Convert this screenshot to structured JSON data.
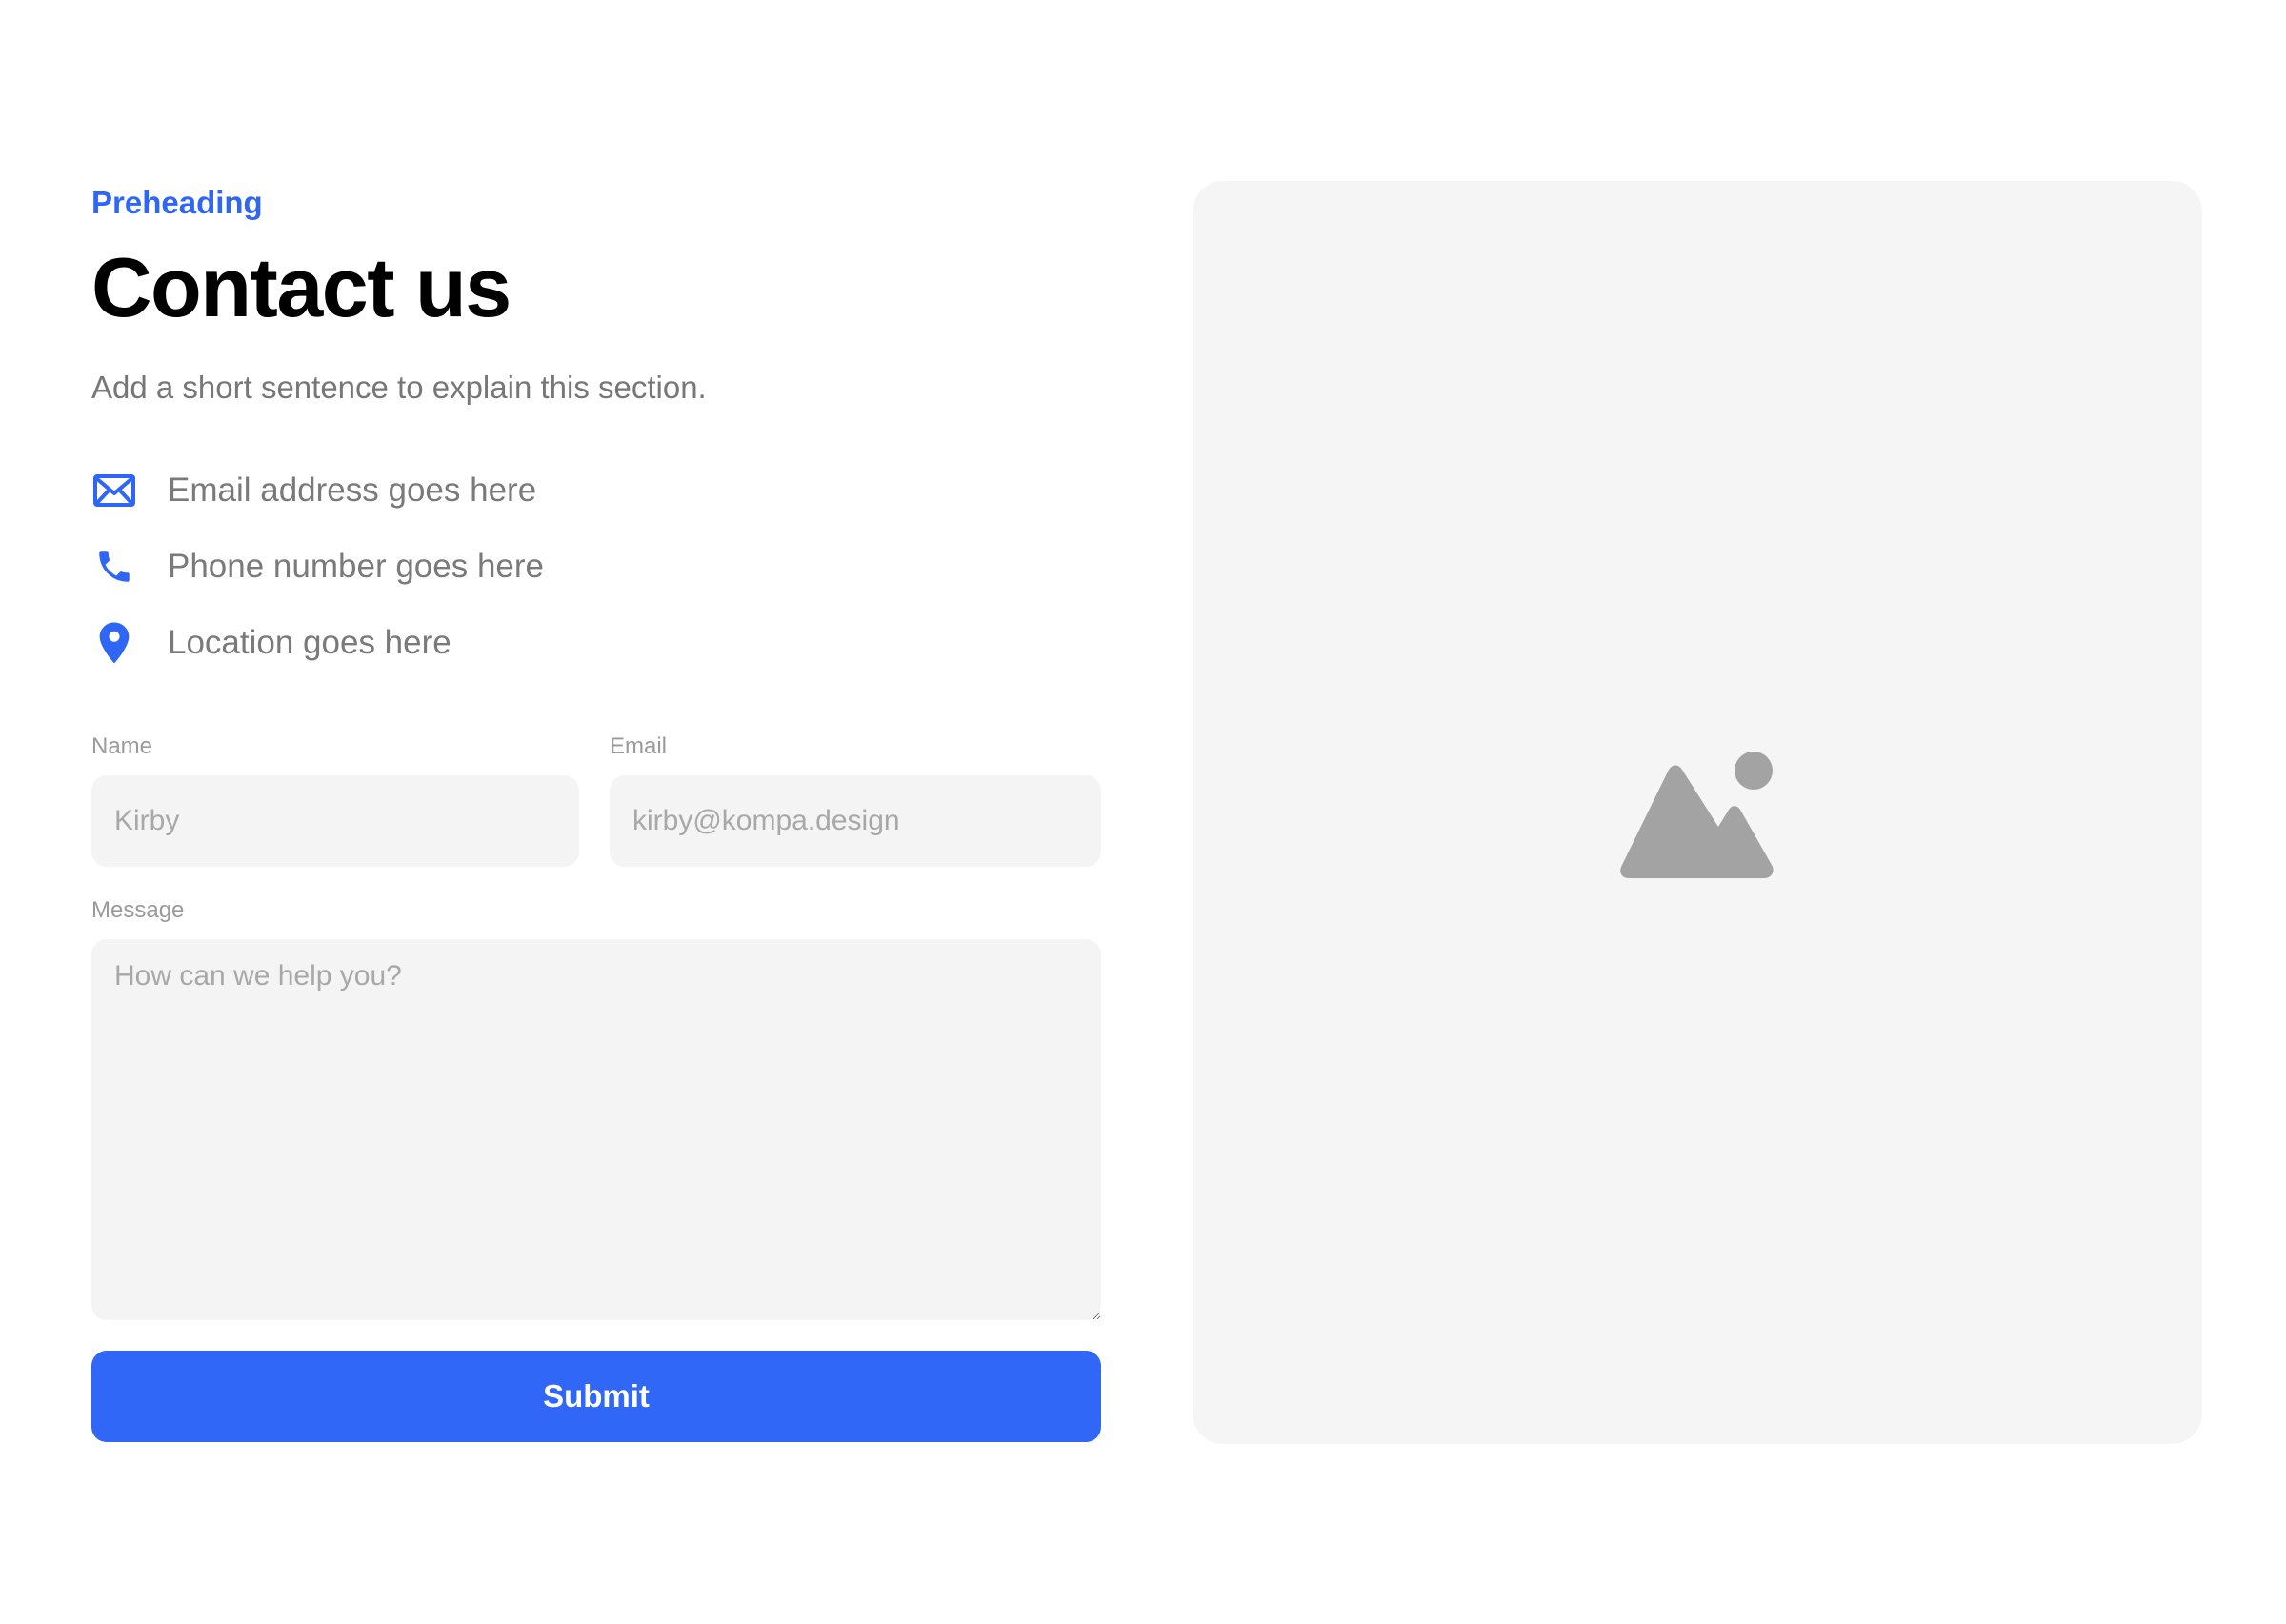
{
  "header": {
    "preheading": "Preheading",
    "title": "Contact us",
    "subtitle": "Add a short sentence to explain this section."
  },
  "contact": {
    "items": [
      {
        "icon": "mail-icon",
        "text": "Email address goes here"
      },
      {
        "icon": "phone-icon",
        "text": "Phone number goes here"
      },
      {
        "icon": "location-pin-icon",
        "text": "Location goes here"
      }
    ]
  },
  "form": {
    "name": {
      "label": "Name",
      "placeholder": "Kirby"
    },
    "email": {
      "label": "Email",
      "placeholder": "kirby@kompa.design"
    },
    "message": {
      "label": "Message",
      "placeholder": "How can we help you?"
    },
    "submit_label": "Submit"
  },
  "image": {
    "icon": "image-placeholder-icon"
  },
  "colors": {
    "accent": "#3067f7",
    "heading": "#000000",
    "muted_text": "#777777",
    "field_bg": "#f4f4f4",
    "image_bg": "#f5f5f5",
    "image_icon": "#a3a3a3"
  }
}
